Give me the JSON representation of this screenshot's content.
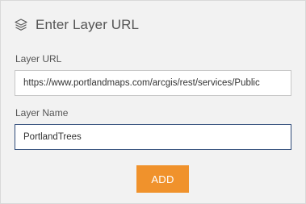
{
  "header": {
    "icon": "layers-icon",
    "title": "Enter Layer URL"
  },
  "form": {
    "layer_url_label": "Layer URL",
    "layer_url_value": "https://www.portlandmaps.com/arcgis/rest/services/Public",
    "layer_name_label": "Layer Name",
    "layer_name_value": "PortlandTrees"
  },
  "actions": {
    "add_label": "ADD"
  },
  "colors": {
    "panel_bg": "#f2f2f2",
    "button_accent": "#f0922c",
    "focus_border": "#2d4a78"
  }
}
